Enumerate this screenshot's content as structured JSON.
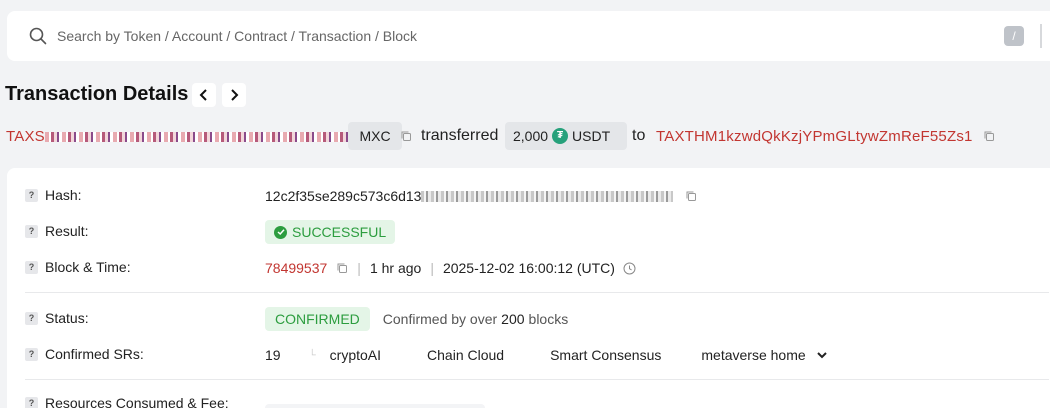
{
  "search": {
    "placeholder": "Search by Token / Account / Contract / Transaction / Block",
    "shortcut": "/"
  },
  "header": {
    "title": "Transaction Details"
  },
  "summary": {
    "from_address": "TAXS",
    "from_tag": "MXC",
    "verb": "transferred",
    "amount": "2,000",
    "token": "USDT",
    "to_word": "to",
    "to_address": "TAXTHM1kzwdQkKzjYPmGLtywZmReF55Zs1"
  },
  "details": {
    "hash": {
      "label": "Hash:",
      "value": "12c2f35se289c573c6d13"
    },
    "result": {
      "label": "Result:",
      "value": "SUCCESSFUL"
    },
    "block_time": {
      "label": "Block & Time:",
      "block": "78499537",
      "ago": "1 hr ago",
      "timestamp": "2025-12-02 16:00:12 (UTC)"
    },
    "status": {
      "label": "Status:",
      "badge": "CONFIRMED",
      "text_prefix": "Confirmed by over",
      "blocks": "200",
      "text_suffix": "blocks"
    },
    "confirmed_srs": {
      "label": "Confirmed SRs:",
      "count": "19",
      "list": [
        "cryptoAI",
        "Chain Cloud",
        "Smart Consensus",
        "metaverse home"
      ]
    },
    "resources": {
      "label": "Resources Consumed & Fee:"
    }
  },
  "colors": {
    "address_red": "#c23631",
    "success_green": "#2c9d3f",
    "usdt_green": "#26a17b"
  },
  "icons": [
    "search-icon",
    "chevron-left-icon",
    "chevron-right-icon",
    "copy-icon",
    "tether-icon",
    "check-circle-icon",
    "clock-icon",
    "question-icon",
    "chevron-down-icon"
  ]
}
